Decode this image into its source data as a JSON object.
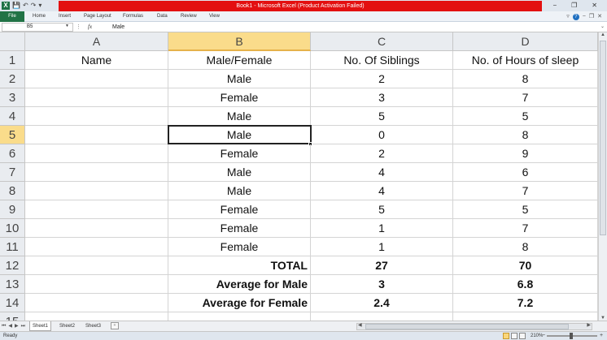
{
  "window": {
    "title": "Book1 - Microsoft Excel (Product Activation Failed)",
    "quick_access": [
      "💾",
      "↶",
      "↷"
    ]
  },
  "ribbon": {
    "file_label": "File",
    "tabs": [
      "Home",
      "Insert",
      "Page Layout",
      "Formulas",
      "Data",
      "Review",
      "View"
    ]
  },
  "formula_bar": {
    "name_box": "B5",
    "fx_label": "fx",
    "value": "Male"
  },
  "sheet": {
    "columns": [
      "A",
      "B",
      "C",
      "D"
    ],
    "selected_column": "B",
    "rows": [
      {
        "n": "1",
        "a": "Name",
        "b": "Male/Female",
        "c": "No. Of Siblings",
        "d": "No. of Hours of sleep"
      },
      {
        "n": "2",
        "a": "",
        "b": "Male",
        "c": "2",
        "d": "8"
      },
      {
        "n": "3",
        "a": "",
        "b": "Female",
        "c": "3",
        "d": "7"
      },
      {
        "n": "4",
        "a": "",
        "b": "Male",
        "c": "5",
        "d": "5"
      },
      {
        "n": "5",
        "a": "",
        "b": "Male",
        "c": "0",
        "d": "8"
      },
      {
        "n": "6",
        "a": "",
        "b": "Female",
        "c": "2",
        "d": "9"
      },
      {
        "n": "7",
        "a": "",
        "b": "Male",
        "c": "4",
        "d": "6"
      },
      {
        "n": "8",
        "a": "",
        "b": "Male",
        "c": "4",
        "d": "7"
      },
      {
        "n": "9",
        "a": "",
        "b": "Female",
        "c": "5",
        "d": "5"
      },
      {
        "n": "10",
        "a": "",
        "b": "Female",
        "c": "1",
        "d": "7"
      },
      {
        "n": "11",
        "a": "",
        "b": "Female",
        "c": "1",
        "d": "8"
      },
      {
        "n": "12",
        "a": "",
        "b": "TOTAL",
        "c": "27",
        "d": "70"
      },
      {
        "n": "13",
        "a": "",
        "b": "Average for Male",
        "c": "3",
        "d": "6.8"
      },
      {
        "n": "14",
        "a": "",
        "b": "Average for Female",
        "c": "2.4",
        "d": "7.2"
      },
      {
        "n": "15",
        "a": "",
        "b": "",
        "c": "",
        "d": ""
      }
    ],
    "active_cell": "B5",
    "selected_row": "5"
  },
  "sheet_tabs": [
    "Sheet1",
    "Sheet2",
    "Sheet3"
  ],
  "active_sheet": "Sheet1",
  "status": {
    "ready": "Ready",
    "zoom": "210%"
  },
  "colors": {
    "title_bar": "#e31010",
    "file_tab": "#217346",
    "selected_header": "#fadc8b"
  }
}
